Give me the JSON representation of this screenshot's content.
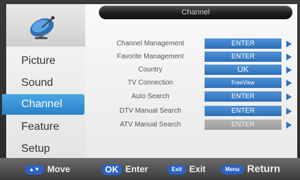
{
  "title": "Channel",
  "menu": [
    {
      "label": "Picture",
      "active": false
    },
    {
      "label": "Sound",
      "active": false
    },
    {
      "label": "Channel",
      "active": true
    },
    {
      "label": "Feature",
      "active": false
    },
    {
      "label": "Setup",
      "active": false
    }
  ],
  "rows": [
    {
      "label": "Channel Management",
      "value": "ENTER",
      "enabled": true
    },
    {
      "label": "Favorite Management",
      "value": "ENTER",
      "enabled": true
    },
    {
      "label": "Country",
      "value": "UK",
      "enabled": true
    },
    {
      "label": "TV Connection",
      "value": "FreeView",
      "enabled": true
    },
    {
      "label": "Auto Search",
      "value": "ENTER",
      "enabled": true
    },
    {
      "label": "DTV Manual Search",
      "value": "ENTER",
      "enabled": true
    },
    {
      "label": "ATV Manual Search",
      "value": "ENTER",
      "enabled": false
    }
  ],
  "hints": [
    {
      "key": "▲▼",
      "label": "Move"
    },
    {
      "key": "OK",
      "label": "Enter"
    },
    {
      "key": "Exit",
      "label": "Exit"
    },
    {
      "key": "Menu",
      "label": "Return"
    }
  ],
  "colors": {
    "accent": "#2d6fb8",
    "active_menu": "#3a95da",
    "disabled": "#a8a8a8"
  }
}
